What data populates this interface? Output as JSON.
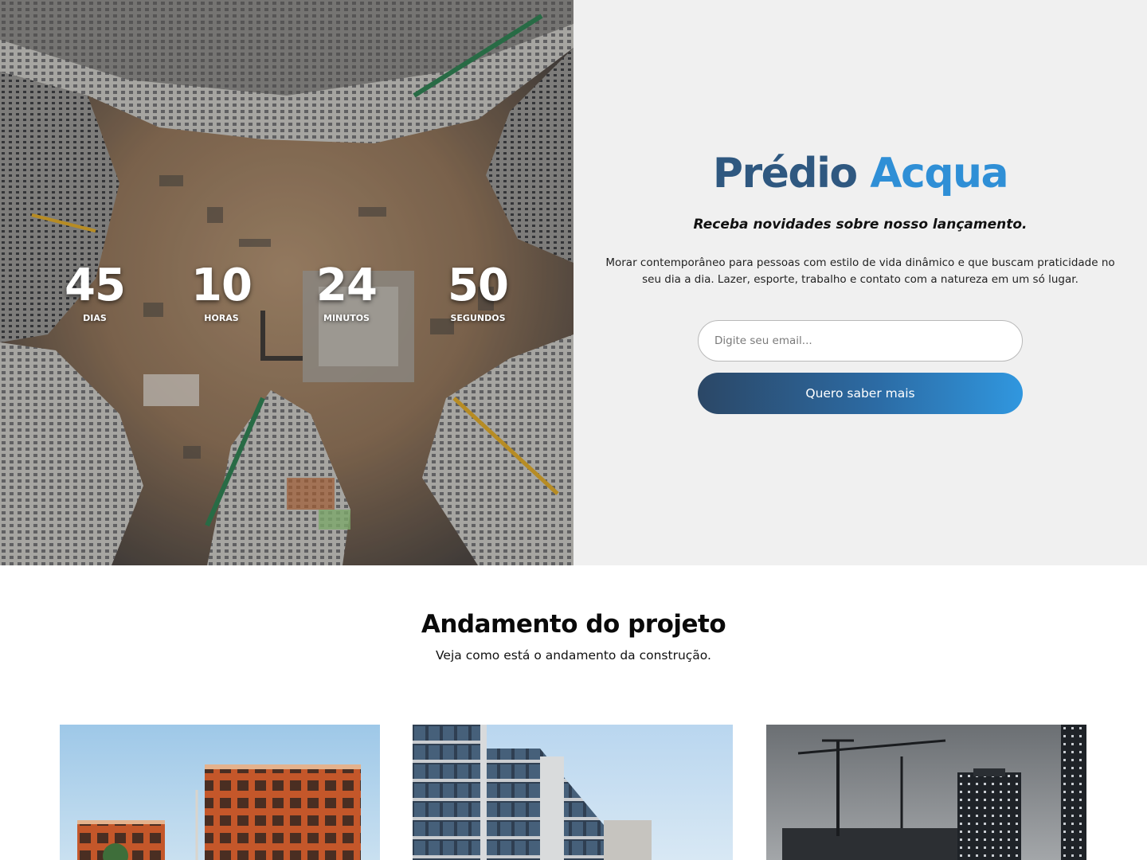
{
  "hero": {
    "photo_icon": "aerial-construction-site-image",
    "countdown": [
      {
        "value": "45",
        "label": "DIAS"
      },
      {
        "value": "10",
        "label": "HORAS"
      },
      {
        "value": "24",
        "label": "MINUTOS"
      },
      {
        "value": "50",
        "label": "SEGUNDOS"
      }
    ]
  },
  "panel": {
    "brand_part1": "Prédio",
    "brand_part2": "Acqua",
    "tagline": "Receba novidades sobre nosso lançamento.",
    "description": "Morar contemporâneo para pessoas com estilo de vida dinâmico e que buscam praticidade no seu dia a dia. Lazer, esporte, trabalho e contato com a natureza em um só lugar.",
    "email_placeholder": "Digite seu email...",
    "cta_label": "Quero saber mais"
  },
  "progress": {
    "title": "Andamento do projeto",
    "subtitle": "Veja como está o andamento da construção.",
    "cards": [
      {
        "icon": "brick-building-construction-image"
      },
      {
        "icon": "glass-tower-image"
      },
      {
        "icon": "cranes-city-image"
      }
    ]
  },
  "colors": {
    "brand_dark": "#2f5880",
    "brand_light": "#2f8fd6",
    "panel_bg": "#f0f0f0",
    "cta_gradient_start": "#2b4766",
    "cta_gradient_end": "#3097df"
  }
}
